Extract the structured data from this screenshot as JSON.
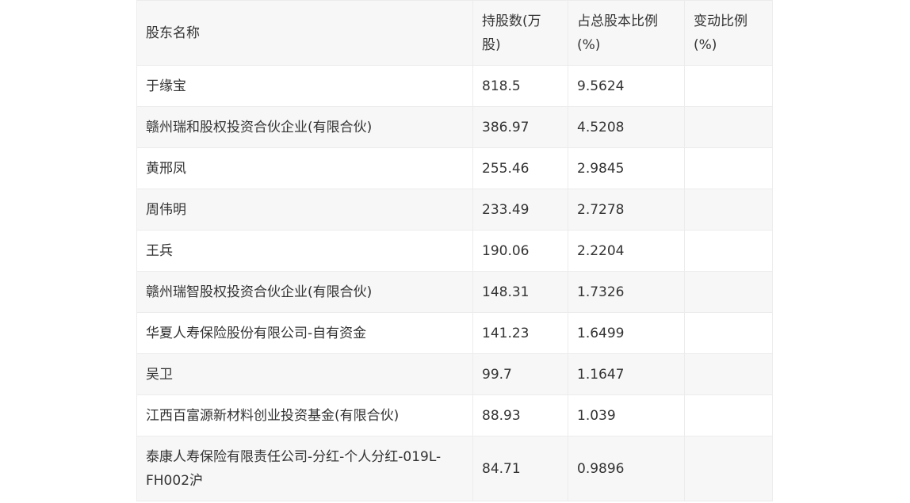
{
  "table": {
    "headers": [
      "股东名称",
      "持股数(万股)",
      "占总股本比例(%)",
      "变动比例(%)"
    ],
    "rows": [
      [
        "于缘宝",
        "818.5",
        "9.5624",
        ""
      ],
      [
        "赣州瑞和股权投资合伙企业(有限合伙)",
        "386.97",
        "4.5208",
        ""
      ],
      [
        "黄邢凤",
        "255.46",
        "2.9845",
        ""
      ],
      [
        "周伟明",
        "233.49",
        "2.7278",
        ""
      ],
      [
        "王兵",
        "190.06",
        "2.2204",
        ""
      ],
      [
        "赣州瑞智股权投资合伙企业(有限合伙)",
        "148.31",
        "1.7326",
        ""
      ],
      [
        "华夏人寿保险股份有限公司-自有资金",
        "141.23",
        "1.6499",
        ""
      ],
      [
        "吴卫",
        "99.7",
        "1.1647",
        ""
      ],
      [
        "江西百富源新材料创业投资基金(有限合伙)",
        "88.93",
        "1.039",
        ""
      ],
      [
        "泰康人寿保险有限责任公司-分红-个人分红-019L-FH002沪",
        "84.71",
        "0.9896",
        ""
      ]
    ]
  }
}
